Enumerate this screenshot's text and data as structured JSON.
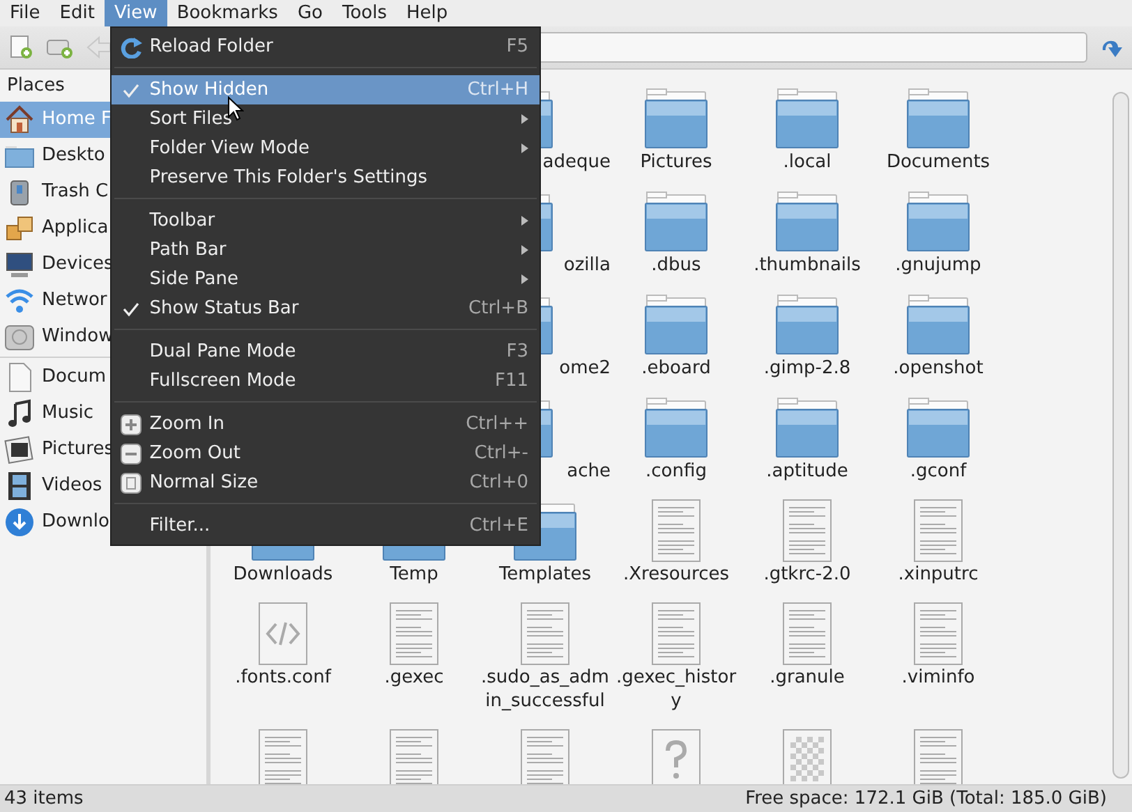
{
  "menubar": [
    {
      "label": "File",
      "selected": false
    },
    {
      "label": "Edit",
      "selected": false
    },
    {
      "label": "View",
      "selected": true
    },
    {
      "label": "Bookmarks",
      "selected": false
    },
    {
      "label": "Go",
      "selected": false
    },
    {
      "label": "Tools",
      "selected": false
    },
    {
      "label": "Help",
      "selected": false
    }
  ],
  "view_menu": [
    {
      "kind": "reload",
      "label": "Reload Folder",
      "shortcut": "F5",
      "selected": false
    },
    {
      "kind": "separator"
    },
    {
      "kind": "toggle",
      "label": "Show Hidden",
      "shortcut": "Ctrl+H",
      "checked": true,
      "selected": true
    },
    {
      "kind": "submenu",
      "label": "Sort Files",
      "selected": false
    },
    {
      "kind": "submenu",
      "label": "Folder View Mode",
      "selected": false
    },
    {
      "kind": "command",
      "label": "Preserve This Folder's Settings",
      "selected": false
    },
    {
      "kind": "separator"
    },
    {
      "kind": "submenu",
      "label": "Toolbar",
      "selected": false
    },
    {
      "kind": "submenu",
      "label": "Path Bar",
      "selected": false
    },
    {
      "kind": "submenu",
      "label": "Side Pane",
      "selected": false
    },
    {
      "kind": "toggle",
      "label": "Show Status Bar",
      "shortcut": "Ctrl+B",
      "checked": true,
      "selected": false
    },
    {
      "kind": "separator"
    },
    {
      "kind": "command",
      "label": "Dual Pane Mode",
      "shortcut": "F3",
      "selected": false
    },
    {
      "kind": "command",
      "label": "Fullscreen Mode",
      "shortcut": "F11",
      "selected": false
    },
    {
      "kind": "separator"
    },
    {
      "kind": "zoomin",
      "label": "Zoom In",
      "shortcut": "Ctrl++",
      "selected": false
    },
    {
      "kind": "zoomout",
      "label": "Zoom Out",
      "shortcut": "Ctrl+-",
      "selected": false
    },
    {
      "kind": "zoomreset",
      "label": "Normal Size",
      "shortcut": "Ctrl+0",
      "selected": false
    },
    {
      "kind": "separator"
    },
    {
      "kind": "command",
      "label": "Filter...",
      "shortcut": "Ctrl+E",
      "selected": false
    }
  ],
  "sidebar": {
    "title": "Places",
    "sections": [
      {
        "items": [
          {
            "kind": "home",
            "label": "Home F",
            "selected": true
          },
          {
            "kind": "folder",
            "label": "Deskto",
            "selected": false
          },
          {
            "kind": "trash",
            "label": "Trash C",
            "selected": false
          },
          {
            "kind": "apps",
            "label": "Applica",
            "selected": false
          },
          {
            "kind": "computer",
            "label": "Devices",
            "selected": false
          },
          {
            "kind": "network",
            "label": "Networ",
            "selected": false
          },
          {
            "kind": "drive",
            "label": "Window",
            "selected": false
          }
        ]
      },
      {
        "items": [
          {
            "kind": "document",
            "label": "Docum",
            "selected": false
          },
          {
            "kind": "music",
            "label": "Music",
            "selected": false
          },
          {
            "kind": "pictures",
            "label": "Pictures",
            "selected": false
          },
          {
            "kind": "videos",
            "label": "Videos",
            "selected": false
          },
          {
            "kind": "download",
            "label": "Downlo",
            "selected": false
          }
        ]
      }
    ]
  },
  "files": [
    [
      {
        "kind": "clipped",
        "name": "adeque"
      },
      {
        "kind": "folder",
        "name": "Pictures"
      },
      {
        "kind": "folder",
        "name": ".local"
      },
      {
        "kind": "folder",
        "name": "Documents"
      }
    ],
    [
      {
        "kind": "clipped",
        "name": "ozilla"
      },
      {
        "kind": "folder",
        "name": ".dbus"
      },
      {
        "kind": "folder",
        "name": ".thumbnails"
      },
      {
        "kind": "folder",
        "name": ".gnujump"
      }
    ],
    [
      {
        "kind": "clipped",
        "name": "ome2"
      },
      {
        "kind": "folder",
        "name": ".eboard"
      },
      {
        "kind": "folder",
        "name": ".gimp-2.8"
      },
      {
        "kind": "folder",
        "name": ".openshot"
      }
    ],
    [
      {
        "kind": "clipped",
        "name": "ache"
      },
      {
        "kind": "folder",
        "name": ".config"
      },
      {
        "kind": "folder",
        "name": ".aptitude"
      },
      {
        "kind": "folder",
        "name": ".gconf"
      }
    ],
    [
      {
        "kind": "folder",
        "name": "Downloads"
      },
      {
        "kind": "folder",
        "name": "Temp"
      },
      {
        "kind": "folder",
        "name": "Templates"
      },
      {
        "kind": "text",
        "name": ".Xresources"
      },
      {
        "kind": "text",
        "name": ".gtkrc-2.0"
      },
      {
        "kind": "text",
        "name": ".xinputrc"
      }
    ],
    [
      {
        "kind": "code",
        "name": ".fonts.conf"
      },
      {
        "kind": "text",
        "name": ".gexec"
      },
      {
        "kind": "text",
        "name": ".sudo_as_admin_successful"
      },
      {
        "kind": "text",
        "name": ".gexec_history"
      },
      {
        "kind": "text",
        "name": ".granule"
      },
      {
        "kind": "text",
        "name": ".viminfo"
      }
    ],
    [
      {
        "kind": "text"
      },
      {
        "kind": "text"
      },
      {
        "kind": "text"
      },
      {
        "kind": "unknown"
      },
      {
        "kind": "image"
      },
      {
        "kind": "text"
      }
    ]
  ],
  "status_bar": {
    "items": "43 items",
    "free_space": "Free space: 172.1 GiB (Total: 185.0 GiB)"
  }
}
